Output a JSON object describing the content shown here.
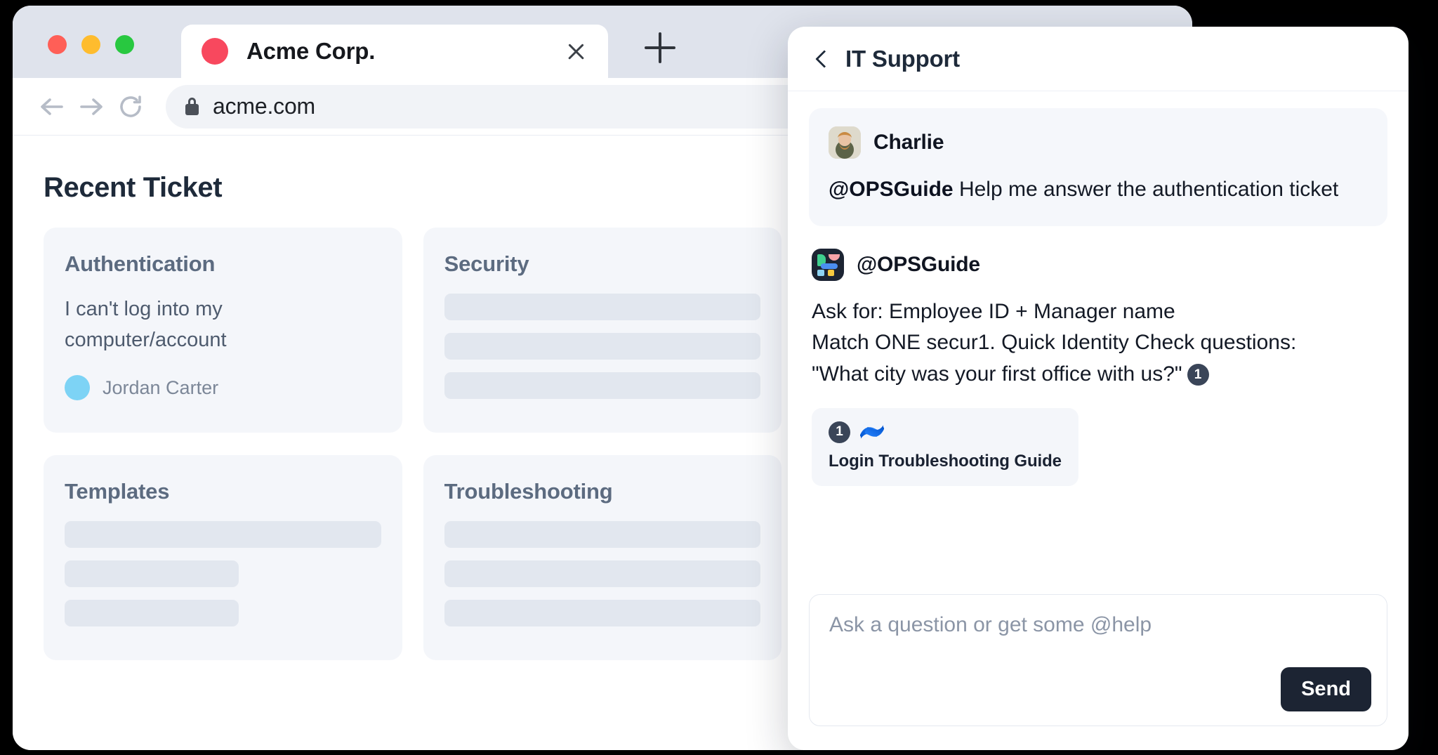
{
  "browser": {
    "traffic_lights": [
      "close",
      "minimize",
      "maximize"
    ],
    "tab": {
      "title": "Acme Corp.",
      "favicon_color": "#f8485e",
      "close_label": "Close tab",
      "new_tab_label": "New tab"
    },
    "toolbar": {
      "back_label": "Back",
      "forward_label": "Forward",
      "reload_label": "Reload",
      "url": "acme.com",
      "secure": true
    }
  },
  "page": {
    "title": "Recent Ticket",
    "cards": [
      {
        "title": "Authentication",
        "body": "I can't log into my computer/account",
        "person": "Jordan Carter",
        "avatar_color": "#7dd3f5",
        "skeletons": []
      },
      {
        "title": "Security",
        "body": "",
        "person": "",
        "skeletons": [
          100,
          100,
          100
        ]
      },
      {
        "title": "Templates",
        "body": "",
        "person": "",
        "skeletons": [
          100,
          55,
          55
        ]
      },
      {
        "title": "Troubleshooting",
        "body": "",
        "person": "",
        "skeletons": [
          100,
          100,
          100
        ]
      }
    ]
  },
  "chat": {
    "header": {
      "back_icon": "chevron-left-icon",
      "title": "IT Support"
    },
    "messages": [
      {
        "type": "user",
        "author": "Charlie",
        "avatar": "photo-avatar",
        "mention": "@OPSGuide",
        "text": " Help me answer the authentication ticket"
      },
      {
        "type": "bot",
        "author": "@OPSGuide",
        "avatar": "opsguide-logo-icon",
        "lines": [
          "Ask for: Employee ID + Manager name",
          "Match ONE secur1. Quick Identity Check questions:",
          "\"What city was your first office with us?\""
        ],
        "citation": "1"
      }
    ],
    "source_card": {
      "number": "1",
      "logo": "confluence-icon",
      "title": "Login Troubleshooting Guide"
    },
    "composer": {
      "placeholder": "Ask a question or get some @help",
      "value": "",
      "send_label": "Send"
    }
  },
  "colors": {
    "accent_dark": "#1c2433",
    "card_bg": "#f4f6fa",
    "skeleton": "#e2e7ef",
    "tabbar": "#dfe3ec",
    "citation": "#3a4558"
  }
}
